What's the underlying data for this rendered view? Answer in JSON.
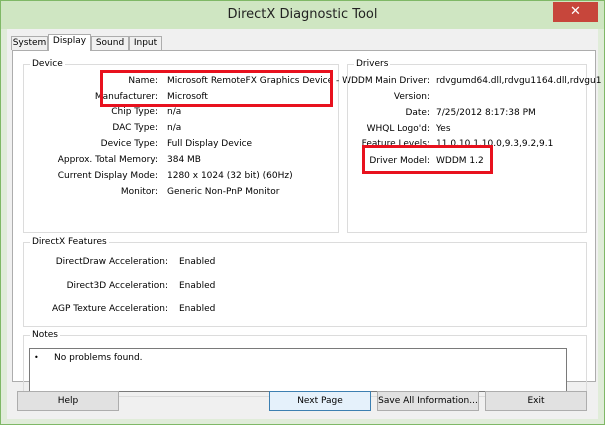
{
  "window": {
    "title": "DirectX Diagnostic Tool",
    "close_glyph": "✕"
  },
  "tabs": [
    {
      "label": "System"
    },
    {
      "label": "Display"
    },
    {
      "label": "Sound"
    },
    {
      "label": "Input"
    }
  ],
  "device": {
    "group_label": "Device",
    "rows": [
      {
        "label": "Name:",
        "value": "Microsoft RemoteFX Graphics Device - WDDM"
      },
      {
        "label": "Manufacturer:",
        "value": "Microsoft"
      },
      {
        "label": "Chip Type:",
        "value": "n/a"
      },
      {
        "label": "DAC Type:",
        "value": "n/a"
      },
      {
        "label": "Device Type:",
        "value": "Full Display Device"
      },
      {
        "label": "Approx. Total Memory:",
        "value": "384 MB"
      },
      {
        "label": "Current Display Mode:",
        "value": "1280 x 1024 (32 bit) (60Hz)"
      },
      {
        "label": "Monitor:",
        "value": "Generic Non-PnP Monitor"
      }
    ]
  },
  "drivers": {
    "group_label": "Drivers",
    "rows": [
      {
        "label": "Main Driver:",
        "value": "rdvgumd64.dll,rdvgu1164.dll,rdvgu1"
      },
      {
        "label": "Version:",
        "value": ""
      },
      {
        "label": "Date:",
        "value": "7/25/2012 8:17:38 PM"
      },
      {
        "label": "WHQL Logo'd:",
        "value": "Yes"
      },
      {
        "label": "Feature Levels:",
        "value": "11.0,10.1,10.0,9.3,9.2,9.1"
      },
      {
        "label": "Driver Model:",
        "value": "WDDM 1.2"
      }
    ]
  },
  "features": {
    "group_label": "DirectX Features",
    "rows": [
      {
        "label": "DirectDraw Acceleration:",
        "value": "Enabled"
      },
      {
        "label": "Direct3D Acceleration:",
        "value": "Enabled"
      },
      {
        "label": "AGP Texture Acceleration:",
        "value": "Enabled"
      }
    ]
  },
  "notes": {
    "group_label": "Notes",
    "bullet": "•",
    "items": [
      "No problems found."
    ]
  },
  "buttons": {
    "help": "Help",
    "next_page": "Next Page",
    "save_all": "Save All Information...",
    "exit": "Exit"
  },
  "colors": {
    "highlight": "#e8111e",
    "titlebar": "#cfe6c2",
    "close": "#c7463b"
  }
}
